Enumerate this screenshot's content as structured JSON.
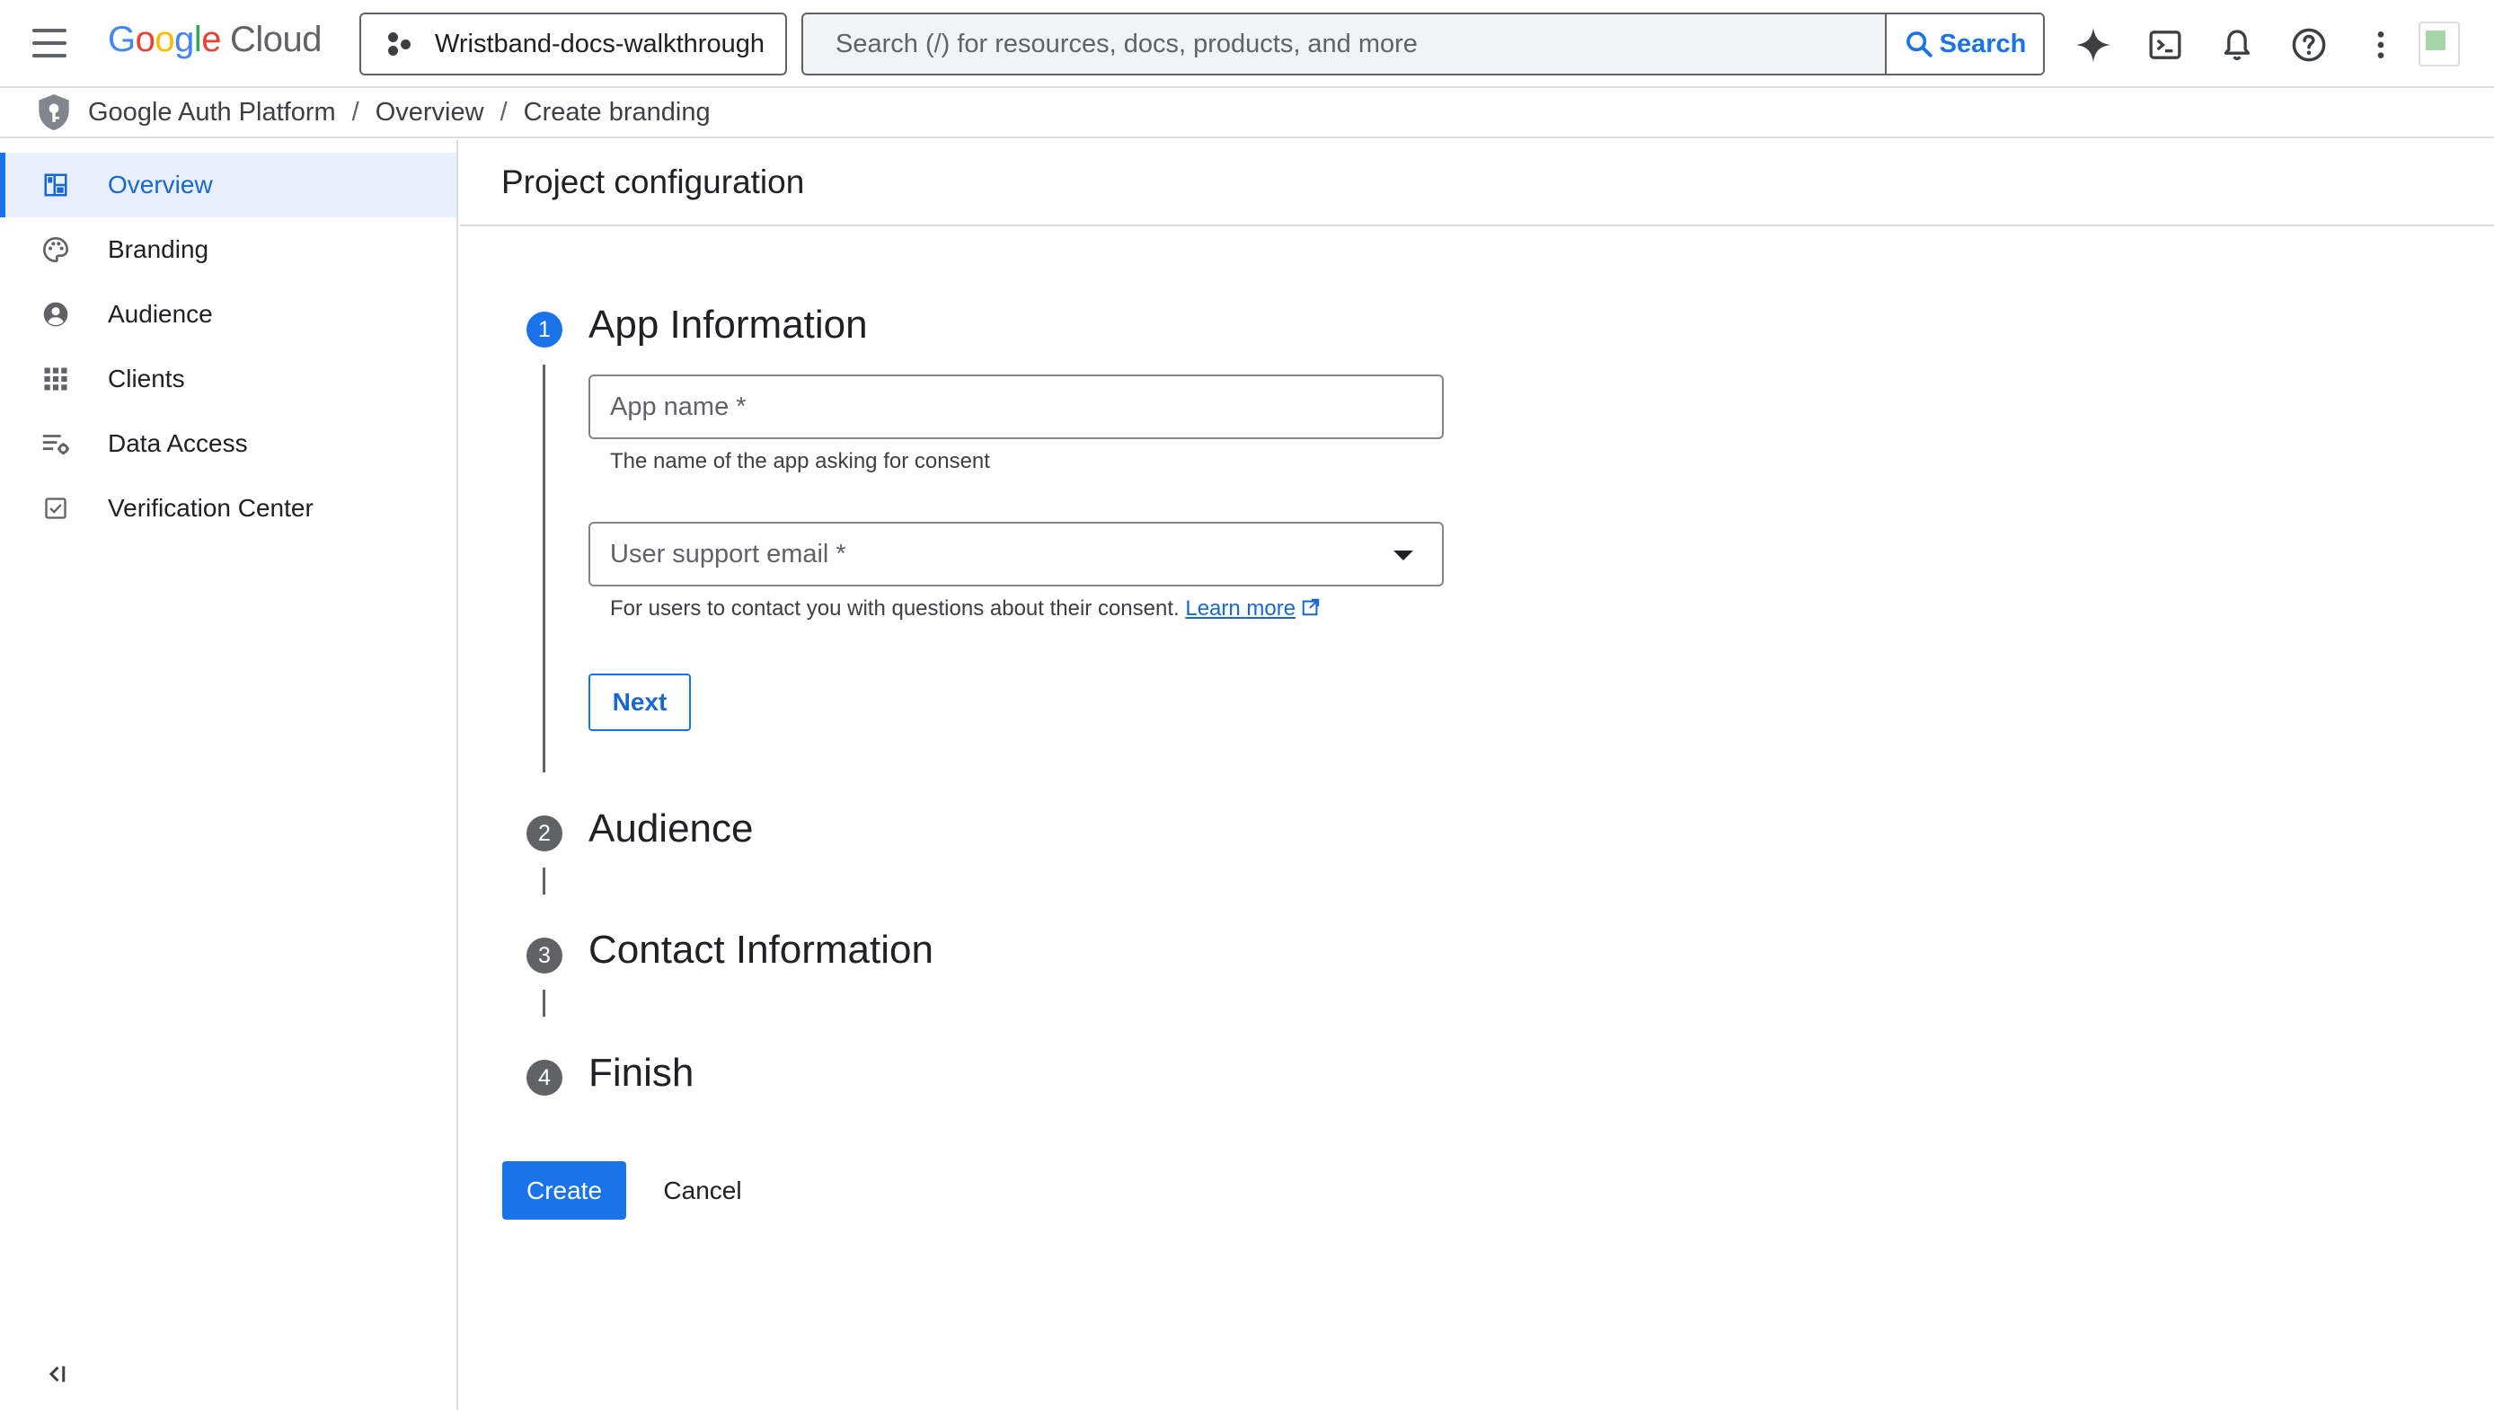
{
  "topbar": {
    "menu_icon": "hamburger-menu-icon",
    "logo": {
      "google_letters": [
        "G",
        "o",
        "o",
        "g",
        "l",
        "e"
      ],
      "google_colors": [
        "#4285F4",
        "#EA4335",
        "#FBBC05",
        "#4285F4",
        "#34A853",
        "#EA4335"
      ],
      "cloud": "Cloud"
    },
    "project_picker": {
      "label": "Wristband-docs-walkthrough",
      "icon": "project-dots-icon"
    },
    "search": {
      "placeholder": "Search (/) for resources, docs, products, and more",
      "value": "",
      "button_label": "Search"
    },
    "icons": [
      "gemini-spark-icon",
      "cloud-shell-icon",
      "notifications-icon",
      "help-icon",
      "more-vert-icon"
    ],
    "accent_color": "#1a73e8"
  },
  "breadcrumb": {
    "items": [
      "Google Auth Platform",
      "Overview",
      "Create branding"
    ],
    "separator": "/"
  },
  "sidebar": {
    "items": [
      {
        "label": "Overview",
        "icon": "dashboard-icon",
        "active": true
      },
      {
        "label": "Branding",
        "icon": "palette-icon",
        "active": false
      },
      {
        "label": "Audience",
        "icon": "account-circle-icon",
        "active": false
      },
      {
        "label": "Clients",
        "icon": "apps-grid-icon",
        "active": false
      },
      {
        "label": "Data Access",
        "icon": "list-settings-icon",
        "active": false
      },
      {
        "label": "Verification Center",
        "icon": "checkbox-icon",
        "active": false
      }
    ],
    "collapse_icon": "collapse-sidebar-icon"
  },
  "main": {
    "title": "Project configuration",
    "steps": [
      {
        "number": "1",
        "title": "App Information",
        "active": true
      },
      {
        "number": "2",
        "title": "Audience",
        "active": false
      },
      {
        "number": "3",
        "title": "Contact Information",
        "active": false
      },
      {
        "number": "4",
        "title": "Finish",
        "active": false
      }
    ],
    "app_name": {
      "placeholder": "App name *",
      "value": "",
      "hint": "The name of the app asking for consent"
    },
    "support_email": {
      "placeholder": "User support email *",
      "hint": "For users to contact you with questions about their consent.",
      "learn_more": "Learn more"
    },
    "next_label": "Next",
    "create_label": "Create",
    "cancel_label": "Cancel"
  }
}
